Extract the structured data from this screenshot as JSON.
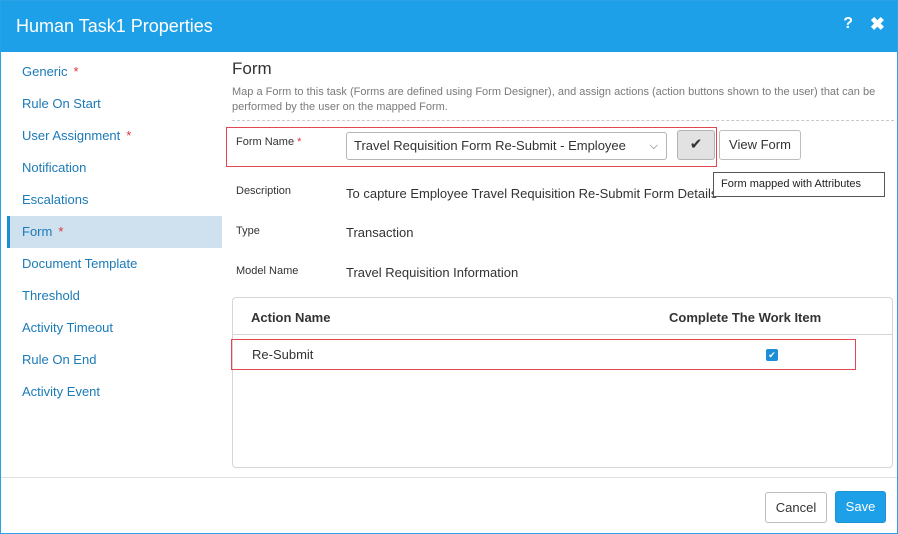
{
  "dialog": {
    "title": "Human Task1 Properties",
    "help_label": "?",
    "close_label": "✖"
  },
  "sidebar": {
    "items": [
      {
        "label": "Generic",
        "required": "*"
      },
      {
        "label": "Rule On Start",
        "required": ""
      },
      {
        "label": "User Assignment",
        "required": "*"
      },
      {
        "label": "Notification",
        "required": ""
      },
      {
        "label": "Escalations",
        "required": ""
      },
      {
        "label": "Form",
        "required": "*",
        "active": true
      },
      {
        "label": "Document Template",
        "required": ""
      },
      {
        "label": "Threshold",
        "required": ""
      },
      {
        "label": "Activity Timeout",
        "required": ""
      },
      {
        "label": "Rule On End",
        "required": ""
      },
      {
        "label": "Activity Event",
        "required": ""
      }
    ]
  },
  "form": {
    "section_title": "Form",
    "description": "Map a Form to this task (Forms are defined using Form Designer), and assign actions (action buttons shown to the user) that can be performed by the user on the mapped Form.",
    "form_name_label": "Form Name",
    "form_name_required": "*",
    "form_name_value": "Travel Requisition Form Re-Submit - Employee",
    "check_button_label": "✔",
    "view_form_label": "View Form",
    "tooltip": "Form mapped with Attributes",
    "description_label": "Description",
    "description_value": "To capture Employee Travel Requisition Re-Submit Form Details",
    "type_label": "Type",
    "type_value": "Transaction",
    "model_name_label": "Model Name",
    "model_name_value": "Travel Requisition Information"
  },
  "actions_table": {
    "columns": [
      "Action Name",
      "Complete The Work Item"
    ],
    "rows": [
      {
        "action_name": "Re-Submit",
        "complete_work_item": true
      }
    ]
  },
  "footer": {
    "cancel_label": "Cancel",
    "save_label": "Save"
  },
  "colors": {
    "accent": "#1ea0e8",
    "required": "#d9363e",
    "highlight_box": "#e0474f"
  }
}
